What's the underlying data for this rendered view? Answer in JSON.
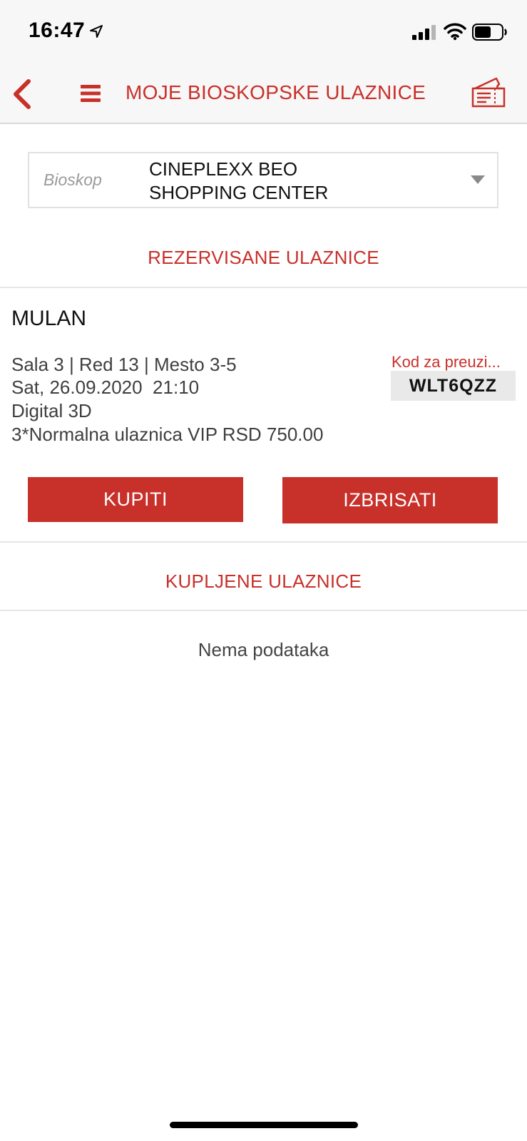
{
  "status_bar": {
    "time": "16:47"
  },
  "nav": {
    "title": "MOJE BIOSKOPSKE ULAZNICE"
  },
  "cinema_select": {
    "label": "Bioskop",
    "value": "CINEPLEXX BEO\nSHOPPING CENTER"
  },
  "reserved": {
    "section_title": "REZERVISANE ULAZNICE",
    "ticket": {
      "movie": "MULAN",
      "hall_row_seat": "Sala 3 | Red 13 | Mesto 3-5",
      "datetime": "Sat, 26.09.2020  21:10",
      "format": "Digital 3D",
      "price_line": "3*Normalna ulaznica VIP RSD 750.00",
      "code_label": "Kod za preuzi...",
      "code": "WLT6QZZ"
    },
    "buy_label": "KUPITI",
    "delete_label": "IZBRISATI"
  },
  "purchased": {
    "section_title": "KUPLJENE ULAZNICE",
    "empty_text": "Nema podataka"
  },
  "colors": {
    "accent": "#c8302a",
    "bar_background": "#f7f7f7"
  }
}
